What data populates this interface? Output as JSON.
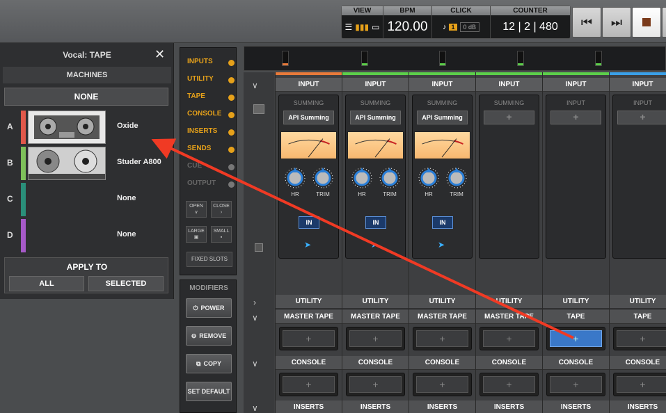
{
  "transport": {
    "view_label": "VIEW",
    "bpm_label": "BPM",
    "bpm_value": "120.00",
    "click_label": "CLICK",
    "click_num": "1",
    "click_level": "0 dB",
    "counter_label": "COUNTER",
    "counter_value": "12 | 2 | 480"
  },
  "panel": {
    "title": "Vocal: TAPE",
    "machines_header": "MACHINES",
    "none_button": "NONE",
    "slots": [
      {
        "letter": "A",
        "name": "Oxide",
        "color": "#e0584a"
      },
      {
        "letter": "B",
        "name": "Studer A800",
        "color": "#7ec05a"
      },
      {
        "letter": "C",
        "name": "None",
        "color": "#2a8f7a"
      },
      {
        "letter": "D",
        "name": "None",
        "color": "#a65ac8"
      }
    ],
    "apply_to": "APPLY TO",
    "all_button": "ALL",
    "selected_button": "SELECTED"
  },
  "modules": {
    "items": [
      {
        "label": "INPUTS",
        "active": true
      },
      {
        "label": "UTILITY",
        "active": true
      },
      {
        "label": "TAPE",
        "active": true
      },
      {
        "label": "CONSOLE",
        "active": true
      },
      {
        "label": "INSERTS",
        "active": true
      },
      {
        "label": "SENDS",
        "active": true
      },
      {
        "label": "CUE",
        "active": false
      },
      {
        "label": "OUTPUT",
        "active": false
      }
    ],
    "open_label": "OPEN",
    "close_label": "CLOSE",
    "large_label": "LARGE",
    "small_label": "SMALL",
    "fixed_slots_label": "FIXED SLOTS"
  },
  "modifiers": {
    "title": "MODIFIERS",
    "power": "POWER",
    "remove": "REMOVE",
    "copy": "COPY",
    "set_default": "SET DEFAULT"
  },
  "mixer": {
    "channels": [
      {
        "color": "#e87a3a",
        "input": "INPUT",
        "summing": "SUMMING",
        "summing_value": "API Summing",
        "has_plugin": true,
        "hr": "HR",
        "trim": "TRIM",
        "in": "IN",
        "utility": "UTILITY",
        "tape": "MASTER TAPE",
        "console": "CONSOLE",
        "inserts": "INSERTS"
      },
      {
        "color": "#5ccf4a",
        "input": "INPUT",
        "summing": "SUMMING",
        "summing_value": "API Summing",
        "has_plugin": true,
        "hr": "HR",
        "trim": "TRIM",
        "in": "IN",
        "utility": "UTILITY",
        "tape": "MASTER TAPE",
        "console": "CONSOLE",
        "inserts": "INSERTS"
      },
      {
        "color": "#5ccf4a",
        "input": "INPUT",
        "summing": "SUMMING",
        "summing_value": "API Summing",
        "has_plugin": true,
        "hr": "HR",
        "trim": "TRIM",
        "in": "IN",
        "utility": "UTILITY",
        "tape": "MASTER TAPE",
        "console": "CONSOLE",
        "inserts": "INSERTS"
      },
      {
        "color": "#5ccf4a",
        "input": "INPUT",
        "summing": "SUMMING",
        "summing_value": "+",
        "has_plugin": false,
        "utility": "UTILITY",
        "tape": "MASTER TAPE",
        "console": "CONSOLE",
        "inserts": "INSERTS"
      },
      {
        "color": "#5ccf4a",
        "input": "INPUT",
        "summing": "INPUT",
        "summing_value": "+",
        "has_plugin": false,
        "utility": "UTILITY",
        "tape": "TAPE",
        "console": "CONSOLE",
        "inserts": "INSERTS",
        "tape_highlight": true
      },
      {
        "color": "#3aa0e8",
        "input": "INPUT",
        "summing": "INPUT",
        "summing_value": "+",
        "has_plugin": false,
        "utility": "UTILITY",
        "tape": "TAPE",
        "console": "CONSOLE",
        "inserts": "INSERTS"
      }
    ],
    "plus": "+"
  },
  "colors": {
    "accent_orange": "#e6a11a",
    "arrow_red": "#f03a24",
    "in_blue": "#1b3a6a",
    "highlight_blue": "#3a78c8"
  }
}
